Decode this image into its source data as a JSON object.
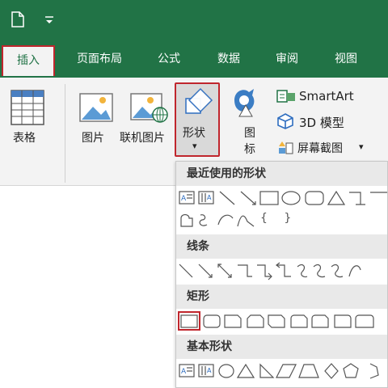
{
  "tabs": [
    {
      "label": "插入",
      "active": true
    },
    {
      "label": "页面布局",
      "active": false
    },
    {
      "label": "公式",
      "active": false
    },
    {
      "label": "数据",
      "active": false
    },
    {
      "label": "审阅",
      "active": false
    },
    {
      "label": "视图",
      "active": false
    }
  ],
  "ribbon": {
    "table_label": "表格",
    "picture_label": "图片",
    "online_picture_label": "联机图片",
    "shapes_label": "形状",
    "icons_label_1": "图",
    "icons_label_2": "标",
    "smartart_label": "SmartArt",
    "model3d_label": "3D 模型",
    "screenshot_label": "屏幕截图",
    "screenshot_arrow": "▾",
    "shapes_arrow": "▾"
  },
  "dropdown": {
    "sections": [
      {
        "title": "最近使用的形状"
      },
      {
        "title": "线条"
      },
      {
        "title": "矩形"
      },
      {
        "title": "基本形状"
      }
    ],
    "recent_braces": "{ }"
  },
  "colors": {
    "accent_green": "#217346",
    "highlight_red": "#c0262d",
    "ribbon_bg": "#f3f3f3"
  }
}
